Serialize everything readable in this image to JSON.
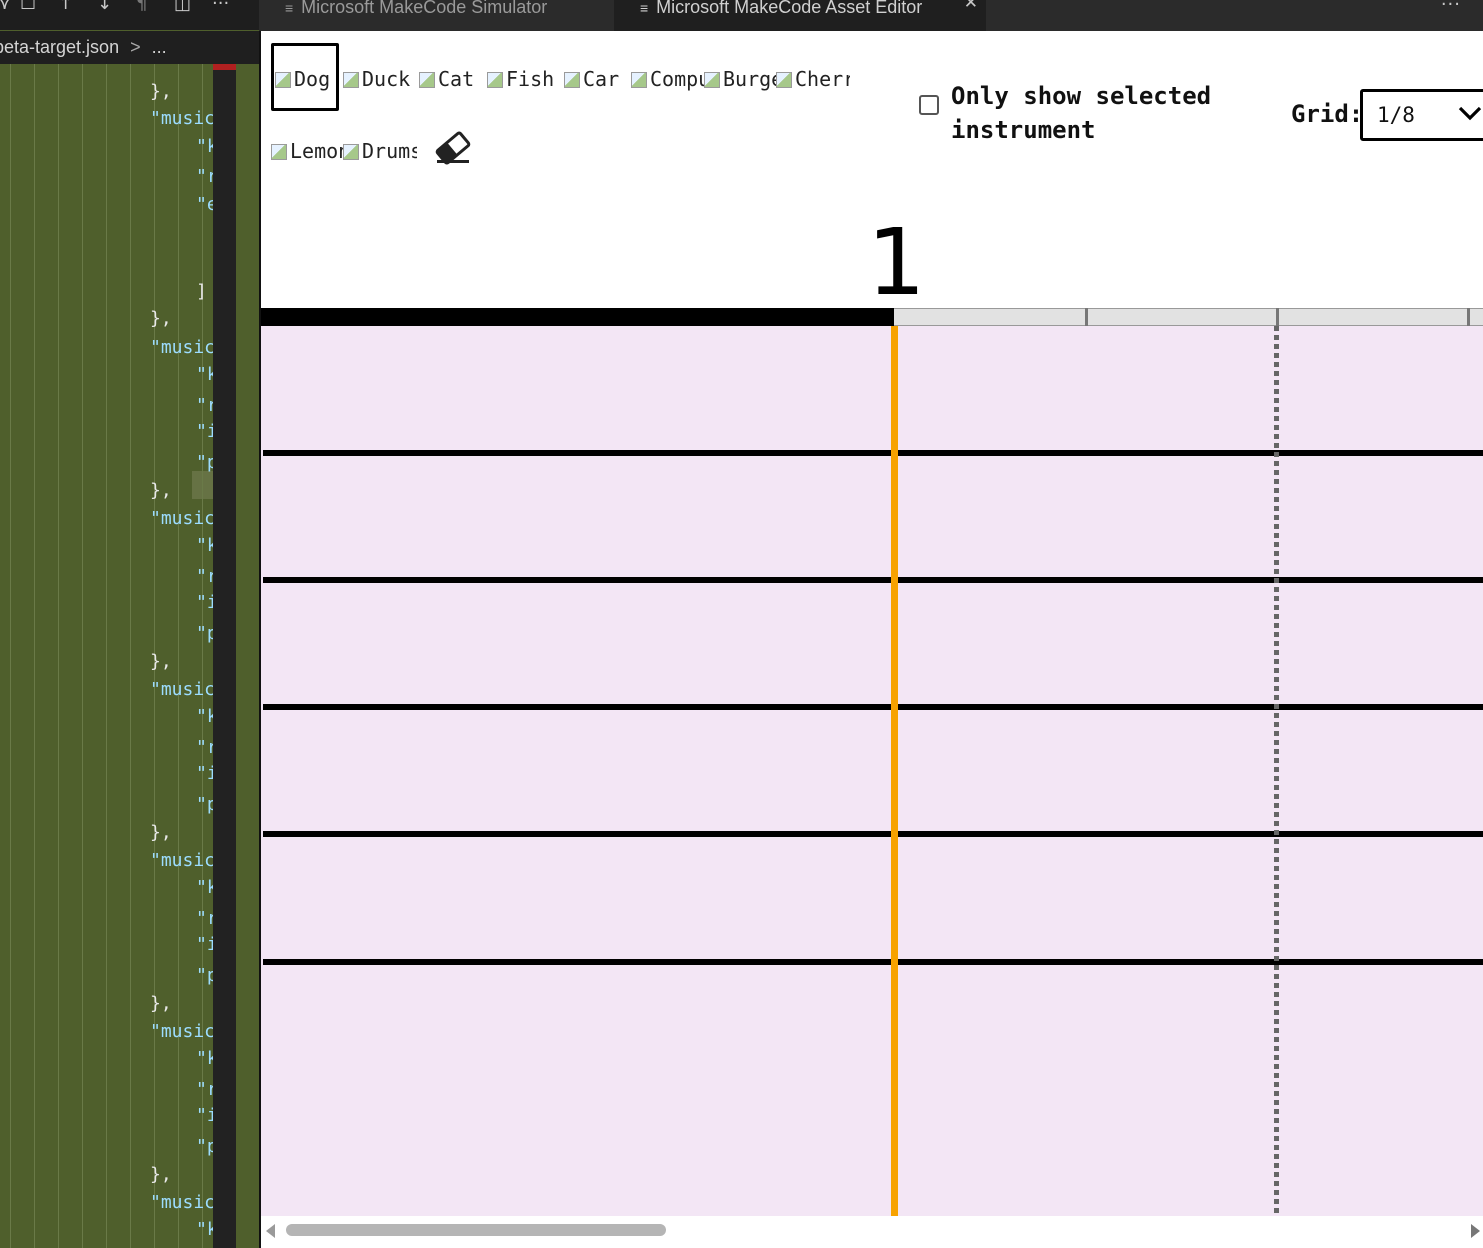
{
  "editor_left": {
    "breadcrumb": {
      "file": "beta-target.json",
      "separator": ">",
      "trail": "..."
    },
    "code_lines": [
      {
        "text": "},",
        "kind": "punct"
      },
      {
        "text": "\"music",
        "kind": "key"
      },
      {
        "text": "\"k",
        "kind": "key"
      },
      {
        "text": "\"r",
        "kind": "key"
      },
      {
        "text": "\"e",
        "kind": "key"
      },
      {
        "text": "]",
        "kind": "punct"
      },
      {
        "text": "},",
        "kind": "punct"
      },
      {
        "text": "\"music",
        "kind": "key"
      },
      {
        "text": "\"k",
        "kind": "key"
      },
      {
        "text": "\"r",
        "kind": "key"
      },
      {
        "text": "\"i",
        "kind": "key"
      },
      {
        "text": "\"p",
        "kind": "key"
      },
      {
        "text": "},",
        "kind": "punct"
      },
      {
        "text": "\"music",
        "kind": "key"
      },
      {
        "text": "\"k",
        "kind": "key"
      },
      {
        "text": "\"r",
        "kind": "key"
      },
      {
        "text": "\"i",
        "kind": "key"
      },
      {
        "text": "\"p",
        "kind": "key"
      },
      {
        "text": "},",
        "kind": "punct"
      },
      {
        "text": "\"music",
        "kind": "key"
      },
      {
        "text": "\"k",
        "kind": "key"
      },
      {
        "text": "\"r",
        "kind": "key"
      },
      {
        "text": "\"i",
        "kind": "key"
      },
      {
        "text": "\"p",
        "kind": "key"
      },
      {
        "text": "},",
        "kind": "punct"
      },
      {
        "text": "\"music",
        "kind": "key"
      },
      {
        "text": "\"k",
        "kind": "key"
      },
      {
        "text": "\"r",
        "kind": "key"
      },
      {
        "text": "\"i",
        "kind": "key"
      },
      {
        "text": "\"p",
        "kind": "key"
      },
      {
        "text": "},",
        "kind": "punct"
      },
      {
        "text": "\"music",
        "kind": "key"
      },
      {
        "text": "\"k",
        "kind": "key"
      },
      {
        "text": "\"r",
        "kind": "key"
      },
      {
        "text": "\"i",
        "kind": "key"
      },
      {
        "text": "\"p",
        "kind": "key"
      },
      {
        "text": "},",
        "kind": "punct"
      },
      {
        "text": "\"music",
        "kind": "key"
      },
      {
        "text": "\"k",
        "kind": "key"
      }
    ]
  },
  "tabs": [
    {
      "label": "Microsoft MakeCode Simulator",
      "active": false
    },
    {
      "label": "Microsoft MakeCode Asset Editor",
      "active": true
    }
  ],
  "tab_icons": {
    "close": "✕",
    "more": "···"
  },
  "instruments": [
    {
      "name": "Dog",
      "selected": true
    },
    {
      "name": "Duck",
      "selected": false
    },
    {
      "name": "Cat",
      "selected": false
    },
    {
      "name": "Fish",
      "selected": false
    },
    {
      "name": "Car",
      "selected": false
    },
    {
      "name": "Computer",
      "selected": false
    },
    {
      "name": "Burger",
      "selected": false
    },
    {
      "name": "Cherry",
      "selected": false
    },
    {
      "name": "Lemon",
      "selected": false
    },
    {
      "name": "Drums",
      "selected": false
    }
  ],
  "only_show_selected": {
    "label": "Only show selected instrument",
    "checked": false
  },
  "grid": {
    "label": "Grid:",
    "value": "1/8"
  },
  "measure": {
    "number": "1"
  },
  "colors": {
    "staff_background": "#f3e6f5",
    "playhead": "#f7a200",
    "editor_background": "#4f5f2c"
  },
  "icons": [
    "eraser-icon",
    "chevron-down-icon",
    "broken-image-icon"
  ]
}
